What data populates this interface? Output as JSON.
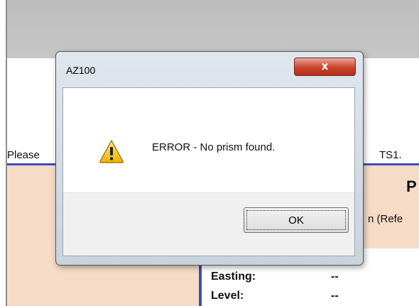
{
  "background": {
    "instruction_left": "Please",
    "instruction_right": "TS1.",
    "heading_partial": "P",
    "reference_partial": "n  (Refe",
    "fields": [
      {
        "label": "Easting:",
        "value": "--"
      },
      {
        "label": "Level:",
        "value": "--"
      }
    ]
  },
  "dialog": {
    "title": "AZ100",
    "close_glyph": "x",
    "icon": "warning-icon",
    "message": "ERROR - No prism found.",
    "ok_label": "OK"
  },
  "colors": {
    "accent_blue": "#3c4fb6",
    "peach": "#f6dcc7",
    "close_red": "#c8422b"
  }
}
